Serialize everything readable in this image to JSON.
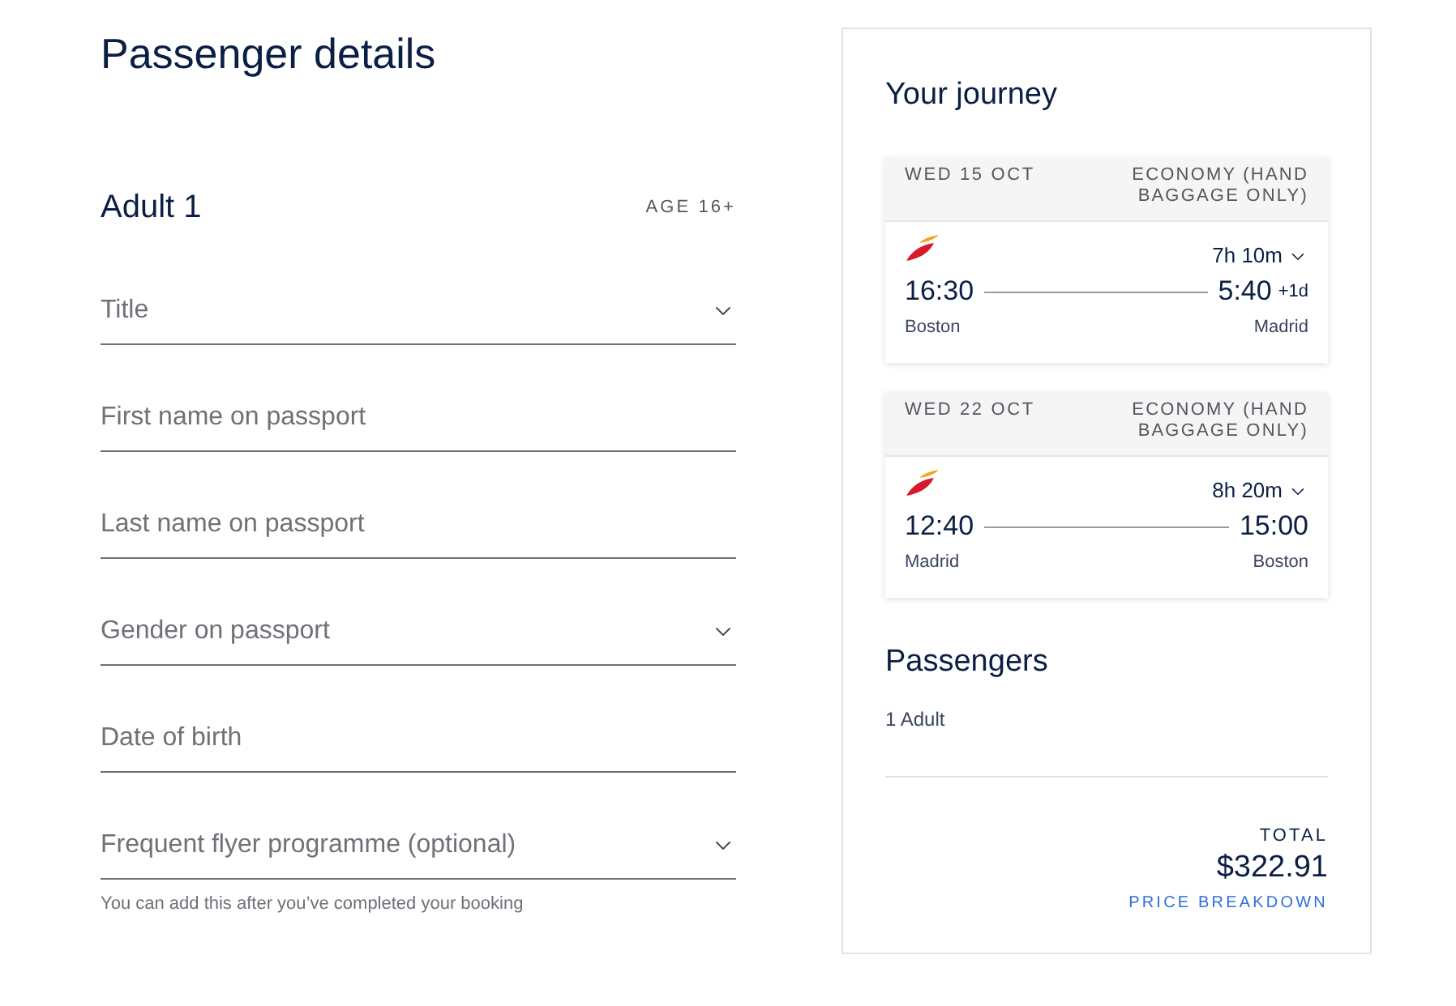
{
  "heading": "Passenger details",
  "passenger": {
    "label": "Adult 1",
    "age": "AGE 16+"
  },
  "fields": [
    {
      "kind": "select",
      "placeholder": "Title"
    },
    {
      "kind": "text",
      "placeholder": "First name on passport"
    },
    {
      "kind": "text",
      "placeholder": "Last name on passport"
    },
    {
      "kind": "select",
      "placeholder": "Gender on passport"
    },
    {
      "kind": "text",
      "placeholder": "Date of birth"
    },
    {
      "kind": "select",
      "placeholder": "Frequent flyer programme (optional)",
      "hint": "You can add this after you’ve completed your booking"
    }
  ],
  "summary": {
    "title": "Your journey",
    "flights": [
      {
        "date": "WED 15 OCT",
        "cabin": "ECONOMY (HAND BAGGAGE ONLY)",
        "duration": "7h 10m",
        "depart_time": "16:30",
        "depart_city": "Boston",
        "arrive_time": "5:40",
        "day_offset": "+1d",
        "arrive_city": "Madrid"
      },
      {
        "date": "WED 22 OCT",
        "cabin": "ECONOMY (HAND BAGGAGE ONLY)",
        "duration": "8h 20m",
        "depart_time": "12:40",
        "depart_city": "Madrid",
        "arrive_time": "15:00",
        "arrive_city": "Boston"
      }
    ],
    "passengers": {
      "title": "Passengers",
      "summary": "1 Adult"
    },
    "total": {
      "label": "TOTAL",
      "amount": "$322.91",
      "link": "PRICE BREAKDOWN"
    }
  }
}
